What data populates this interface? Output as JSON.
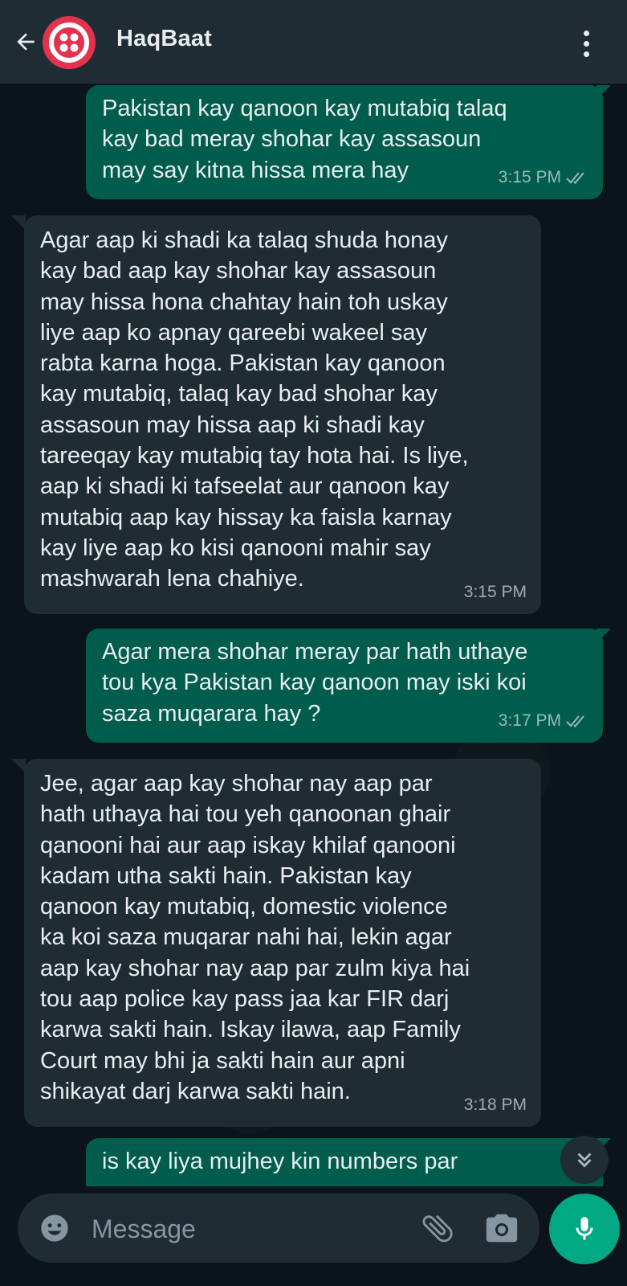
{
  "header": {
    "title": "HaqBaat"
  },
  "messages": [
    {
      "direction": "out",
      "text": "Pakistan kay qanoon kay mutabiq talaq\nkay bad meray shohar kay assasoun\nmay say kitna hissa mera hay",
      "time": "3:15 PM",
      "status": "read"
    },
    {
      "direction": "in",
      "text": "Agar aap ki shadi ka talaq shuda honay\nkay bad aap kay shohar kay assasoun\nmay hissa hona chahtay hain toh uskay\nliye aap ko apnay qareebi wakeel say\nrabta karna hoga. Pakistan kay qanoon\nkay mutabiq, talaq kay bad shohar kay\nassasoun may hissa aap ki shadi kay\ntareeqay kay mutabiq tay hota hai. Is liye,\naap ki shadi ki tafseelat aur qanoon kay\nmutabiq aap kay hissay ka faisla karnay\nkay liye aap ko kisi qanooni mahir say\nmashwarah lena chahiye.",
      "time": "3:15 PM"
    },
    {
      "direction": "out",
      "text": "Agar mera shohar meray par hath uthaye\ntou kya Pakistan kay qanoon may iski koi\nsaza muqarara hay ?",
      "time": "3:17 PM",
      "status": "read"
    },
    {
      "direction": "in",
      "text": "Jee, agar aap kay shohar nay aap par\nhath uthaya hai tou yeh qanoonan ghair\nqanooni hai aur aap iskay khilaf qanooni\nkadam utha sakti hain. Pakistan kay\nqanoon kay mutabiq, domestic violence\nka koi saza muqarar nahi hai, lekin agar\naap kay shohar nay aap par zulm kiya hai\ntou aap police kay pass jaa kar FIR darj\nkarwa sakti hain. Iskay ilawa, aap Family\nCourt may bhi ja sakti hain aur apni\nshikayat darj karwa sakti hain.",
      "time": "3:18 PM"
    },
    {
      "direction": "out",
      "text": "is kay liya mujhey kin numbers par"
    }
  ],
  "composer": {
    "placeholder": "Message"
  },
  "icons": {
    "back": "arrow-left-icon",
    "avatar": "twilio-logo",
    "menu": "more-vert-icon",
    "read": "double-check-icon",
    "scroll": "chevron-double-down-icon",
    "emoji": "emoji-icon",
    "attach": "paperclip-icon",
    "camera": "camera-icon",
    "mic": "mic-icon"
  },
  "colors": {
    "header_bg": "#1f2c34",
    "chat_bg": "#0b141a",
    "outgoing_bubble": "#005c4b",
    "incoming_bubble": "#1f2c34",
    "accent": "#00a884",
    "avatar_red": "#e3324d"
  }
}
